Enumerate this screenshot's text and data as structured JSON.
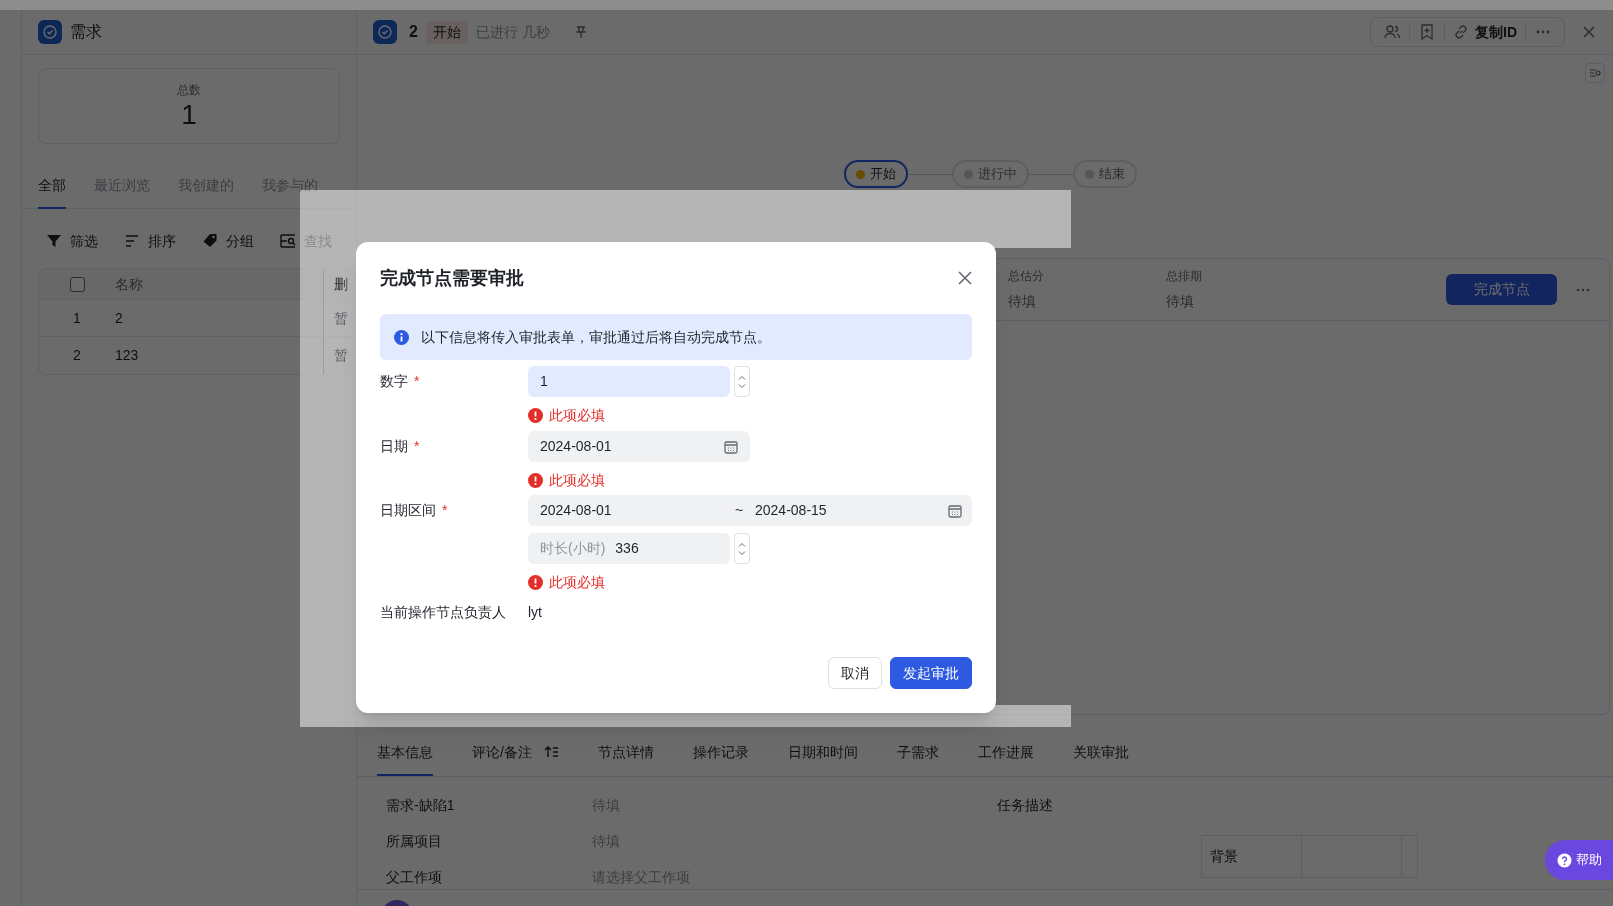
{
  "list_panel": {
    "title": "需求",
    "stat": {
      "label": "总数",
      "value": "1"
    },
    "tabs": [
      {
        "label": "全部",
        "selected": true
      },
      {
        "label": "最近浏览",
        "selected": false
      },
      {
        "label": "我创建的",
        "selected": false
      },
      {
        "label": "我参与的",
        "selected": false
      }
    ],
    "toolbar": [
      {
        "kind": "filter",
        "label": "筛选"
      },
      {
        "kind": "sort",
        "label": "排序"
      },
      {
        "kind": "group",
        "label": "分组"
      },
      {
        "kind": "find",
        "label": "查找"
      }
    ],
    "table": {
      "header_checked": false,
      "columns": [
        "名称",
        "删"
      ],
      "rows": [
        {
          "index": "1",
          "name": "2",
          "column_3": "暂"
        },
        {
          "index": "2",
          "name": "123",
          "column_3": "暂"
        }
      ]
    }
  },
  "detail": {
    "title": "2",
    "status_tag": "开始",
    "elapsed": "已进行 几秒",
    "copy_id": "复制ID",
    "workflow": [
      {
        "label": "开始",
        "selected": true
      },
      {
        "label": "进行中",
        "selected": false
      },
      {
        "label": "结束",
        "selected": false
      }
    ],
    "summary": [
      {
        "label": "总估分",
        "value": "待填"
      },
      {
        "label": "总排期",
        "value": "待填"
      }
    ],
    "complete_button": "完成节点",
    "tabs": [
      {
        "label": "基本信息",
        "selected": true
      },
      {
        "label": "评论/备注",
        "selected": false,
        "sort_icon": true
      },
      {
        "label": "节点详情",
        "selected": false
      },
      {
        "label": "操作记录",
        "selected": false
      },
      {
        "label": "日期和时间",
        "selected": false
      },
      {
        "label": "子需求",
        "selected": false
      },
      {
        "label": "工作进展",
        "selected": false
      },
      {
        "label": "关联审批",
        "selected": false
      }
    ],
    "fields": [
      {
        "label": "需求-缺陷1",
        "placeholder": "待填"
      },
      {
        "label": "所属项目",
        "placeholder": "待填"
      },
      {
        "label": "父工作项",
        "placeholder": "请选择父工作项"
      }
    ],
    "description_label": "任务描述",
    "description_table_header": "背景"
  },
  "help_button": "帮助",
  "dialog": {
    "title": "完成节点需要审批",
    "notice": "以下信息将传入审批表单，审批通过后将自动完成节点。",
    "fields": [
      {
        "kind": "number",
        "label": "数字",
        "required_mark": "*",
        "value": "1",
        "focused": true,
        "error": "此项必填"
      },
      {
        "kind": "date",
        "label": "日期",
        "required_mark": "*",
        "value": "2024-08-01",
        "focused": false,
        "error": "此项必填"
      },
      {
        "kind": "range",
        "label": "日期区间",
        "required_mark": "*",
        "start": "2024-08-01",
        "separator": "~",
        "end": "2024-08-15",
        "duration_label": "时长(小时)",
        "duration": "336",
        "focused": false,
        "error": "此项必填"
      },
      {
        "kind": "text",
        "label": "当前操作节点负责人",
        "value": "lyt"
      }
    ],
    "buttons": [
      {
        "kind": "secondary",
        "label": "取消"
      },
      {
        "kind": "primary",
        "label": "发起审批"
      }
    ]
  }
}
